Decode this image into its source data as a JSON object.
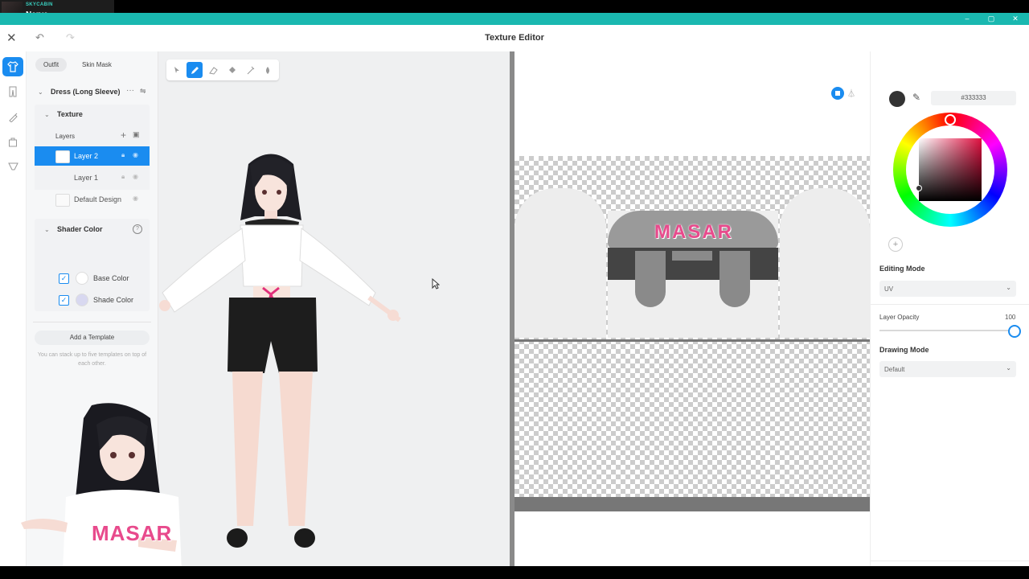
{
  "overlay": {
    "channel": "SKYCABIN",
    "song": "Nerve"
  },
  "window_controls": {
    "minimize": "–",
    "maximize": "▢",
    "close": "✕"
  },
  "header": {
    "title": "Texture Editor"
  },
  "left_panel": {
    "tabs": [
      {
        "label": "Outfit",
        "selected": true
      },
      {
        "label": "Skin Mask",
        "selected": false
      }
    ],
    "item_name": "Dress (Long Sleeve)",
    "texture": {
      "title": "Texture",
      "layers_label": "Layers",
      "layers": [
        {
          "name": "Layer 2",
          "selected": true
        },
        {
          "name": "Layer 1",
          "selected": false
        },
        {
          "name": "Default Design",
          "selected": false
        }
      ]
    },
    "shader": {
      "title": "Shader Color",
      "items": [
        {
          "label": "Base Color",
          "checked": true,
          "color": "#ffffff"
        },
        {
          "label": "Shade Color",
          "checked": true,
          "color": "#d8d8f0"
        }
      ]
    },
    "add_template": {
      "button": "Add a Template",
      "note": "You can stack up to five templates on top of each other."
    }
  },
  "uv_texture": {
    "logo_text": "MASAR"
  },
  "avatar_shirt_text": "MASAR",
  "right_panel": {
    "hex": "#333333",
    "current_color": "#333333",
    "editing_mode": {
      "label": "Editing Mode",
      "value": "UV"
    },
    "layer_opacity": {
      "label": "Layer Opacity",
      "value": "100"
    },
    "drawing_mode": {
      "label": "Drawing Mode",
      "value": "Default"
    }
  },
  "accent": "#1a8cf0",
  "titlebar_color": "#1ab8b0"
}
